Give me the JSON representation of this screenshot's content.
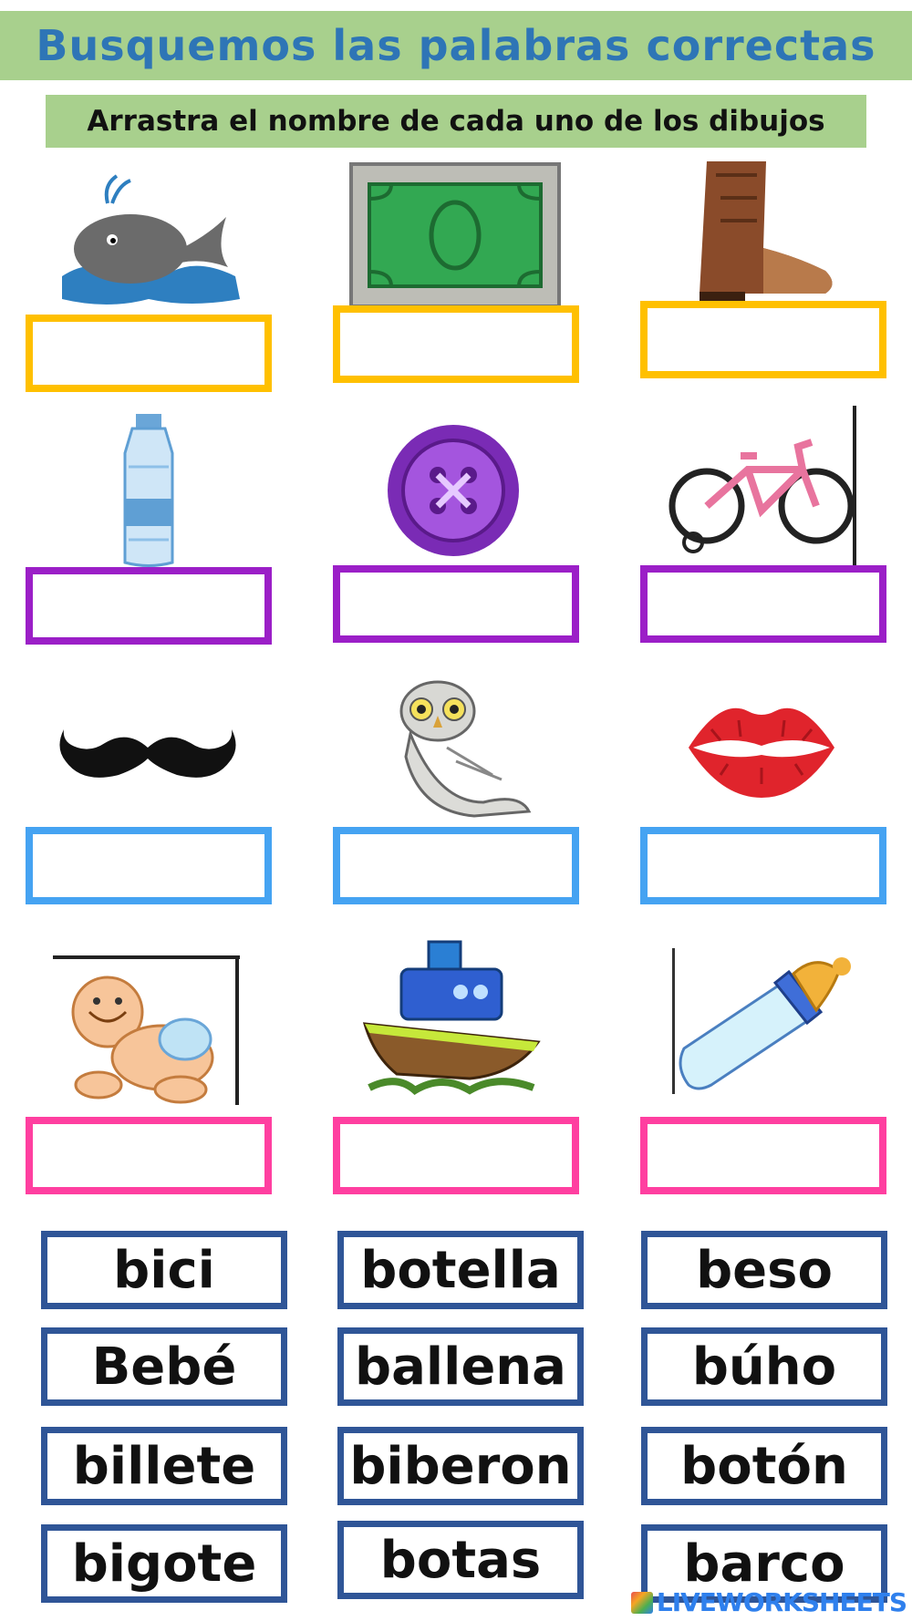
{
  "header": {
    "title": "Busquemos las palabras correctas",
    "instruction": "Arrastra el nombre de cada uno de los dibujos"
  },
  "pictures": [
    {
      "icon": "whale-icon"
    },
    {
      "icon": "banknote-icon"
    },
    {
      "icon": "cowboy-boot-icon"
    },
    {
      "icon": "water-bottle-icon"
    },
    {
      "icon": "button-icon"
    },
    {
      "icon": "bicycle-icon"
    },
    {
      "icon": "mustache-icon"
    },
    {
      "icon": "owl-icon"
    },
    {
      "icon": "lips-kiss-icon"
    },
    {
      "icon": "baby-icon"
    },
    {
      "icon": "boat-icon"
    },
    {
      "icon": "baby-bottle-icon"
    }
  ],
  "slot_colors": [
    "#ffc000",
    "#9b1fc7",
    "#45a3f2",
    "#ff3fa0"
  ],
  "word_bank": [
    "bici",
    "botella",
    "beso",
    "Bebé",
    "ballena",
    "búho",
    "billete",
    "biberon",
    "botón",
    "bigote",
    "botas",
    "barco"
  ],
  "footer": {
    "brand": "LIVEWORKSHEETS"
  }
}
